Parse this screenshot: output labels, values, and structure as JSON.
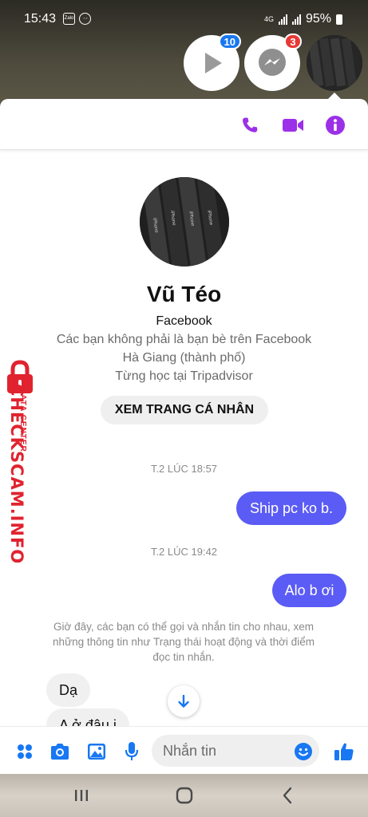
{
  "status_bar": {
    "time": "15:43",
    "app_icons": [
      "Zalo",
      "messenger-icon"
    ],
    "network": "4G",
    "battery": "95%"
  },
  "chat_heads": [
    {
      "name": "video-app",
      "badge": "10",
      "badge_color": "#1877f2"
    },
    {
      "name": "messenger",
      "badge": "3",
      "badge_color": "#e53935"
    },
    {
      "name": "active-chat-avatar"
    }
  ],
  "header_actions": {
    "accent": "#9b30e8",
    "icons": [
      "phone-icon",
      "video-call-icon",
      "info-icon"
    ]
  },
  "profile": {
    "name": "Vũ Téo",
    "subtitle": "Facebook",
    "info_lines": [
      "Các bạn không phải là bạn bè trên Facebook",
      "Hà Giang (thành phố)",
      "Từng học tại Tripadvisor"
    ],
    "view_profile_button": "XEM TRANG CÁ NHÂN",
    "photo_text": [
      "iPhone",
      "iPhone",
      "iPhone",
      "iPhone"
    ]
  },
  "messages": {
    "timestamp_1": "T.2 LÚC 18:57",
    "outgoing_1": "Ship pc ko b.",
    "timestamp_2": "T.2 LÚC 19:42",
    "outgoing_2": "Alo b ơi",
    "notice": "Giờ đây, các bạn có thể gọi và nhắn tin cho nhau, xem những thông tin như Trạng thái hoạt động và thời điểm đọc tin nhắn.",
    "incoming_1": "Dạ",
    "incoming_2": "A ở đâu ị",
    "outgoing_color": "#5b5bf5"
  },
  "composer": {
    "placeholder": "Nhắn tin",
    "accent": "#1877f2",
    "icons": [
      "menu-icon",
      "camera-icon",
      "gallery-icon",
      "microphone-icon",
      "emoji-icon",
      "like-icon"
    ]
  },
  "watermark": {
    "text": "CHECKSCAM.INFO",
    "subtext": "DATA CENTER",
    "color": "#e0232f"
  }
}
